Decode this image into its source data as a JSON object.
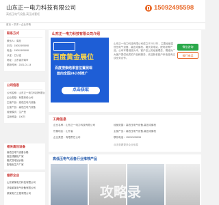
{
  "header": {
    "company": "山东正一电力科技有限公司",
    "subtitle": "高低压电气设备,高压成套柜",
    "phone": "15092495598"
  },
  "breadcrumb": "首页  >  供求  >  企业详情",
  "contact": {
    "title": "联系方式",
    "rows": [
      {
        "label": "联系人：",
        "value": "周总"
      },
      {
        "label": "手机：",
        "value": "15092495598"
      },
      {
        "label": "电话：",
        "value": "15092495598"
      },
      {
        "label": "认证：",
        "value": "已认证"
      },
      {
        "label": "地址：",
        "value": "山东省济南市"
      },
      {
        "label": "更新时间：",
        "value": "2021-01-14"
      }
    ]
  },
  "company_intro": {
    "title": "公司信息",
    "rows": [
      "公司名称：山东正一电力科技有限公司",
      "企业类型：有限责任公司",
      "主营产品：高低压电气设备",
      "主营产品：高低压电气设备",
      "经营模式：生产型",
      "注册资金：100万"
    ]
  },
  "related": {
    "title": "相关高压设备",
    "items": [
      "高低压电气设备价格",
      "高压成套柜厂家",
      "箱式变电站价格",
      "配电柜生产厂家"
    ]
  },
  "recommend": {
    "title": "推荐企业",
    "items": [
      "山东某某电力科技有限公司",
      "济南某某电气设备有限公司",
      "某某电力工程有限公司"
    ]
  },
  "main": {
    "title": "山东正一电力科技有限公司介绍",
    "ad": {
      "headline": "百度黄金展位",
      "line1": "百度搜索结果首位置展现",
      "line2": "面向全国24小时推广",
      "button": "点击获取"
    },
    "description": "山东正一电力科技有限公司成立于2012年，主要经营高低压电气设备、高压成套柜、箱式变电站、配电柜等产品，公司本着诚信为本、客户至上的经营理念，竭诚为广大客户提供优质的产品和服务，欢迎新老客户来电咨询洽谈业务合作。",
    "wechat_button": "微信咨询",
    "dial_button": "拨打电话"
  },
  "business": {
    "title": "工商信息",
    "cells": [
      {
        "label": "企业名称：",
        "value": "山东正一电力科技有限公司"
      },
      {
        "label": "经营范围：",
        "value": "高低压电气设备,高压成套柜"
      },
      {
        "label": "所属地区：",
        "value": "山东省"
      },
      {
        "label": "主营产品：",
        "value": "高低压电气设备,高压成套柜"
      },
      {
        "label": "企业类型：",
        "value": "有限责任公司"
      },
      {
        "label": "联系电话：",
        "value": "15092495598"
      }
    ],
    "more": "点击查看更多企业信息"
  },
  "products": {
    "title": "高低压电气设备行业推荐产品",
    "watermark": "攻略录"
  },
  "colors": {
    "accent": "#e86a2a",
    "brand_red": "#c9302c",
    "ad_blue": "#1e5ed6",
    "wechat_green": "#2aa84a"
  }
}
